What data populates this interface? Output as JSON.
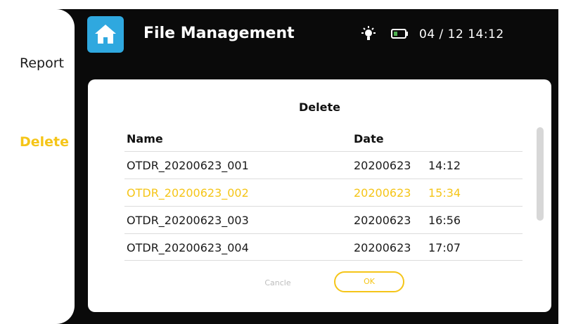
{
  "sidebar": {
    "items": [
      {
        "label": "Report"
      },
      {
        "label": "Delete",
        "active": true
      }
    ]
  },
  "header": {
    "title": "File Management",
    "icons": [
      "home-icon",
      "brightness-icon",
      "battery-icon"
    ],
    "datetime": "04 / 12  14:12"
  },
  "dialog": {
    "title": "Delete",
    "columns": {
      "name": "Name",
      "date": "Date"
    },
    "rows": [
      {
        "name": "OTDR_20200623_001",
        "date": "20200623",
        "time": "14:12",
        "selected": false
      },
      {
        "name": "OTDR_20200623_002",
        "date": "20200623",
        "time": "15:34",
        "selected": true
      },
      {
        "name": "OTDR_20200623_003",
        "date": "20200623",
        "time": "16:56",
        "selected": false
      },
      {
        "name": "OTDR_20200623_004",
        "date": "20200623",
        "time": "17:07",
        "selected": false
      }
    ],
    "cancel_label": "Cancle",
    "ok_label": "OK"
  },
  "colors": {
    "accent": "#f5c518",
    "home_button": "#2fa8df",
    "background": "#0a0a0a"
  }
}
